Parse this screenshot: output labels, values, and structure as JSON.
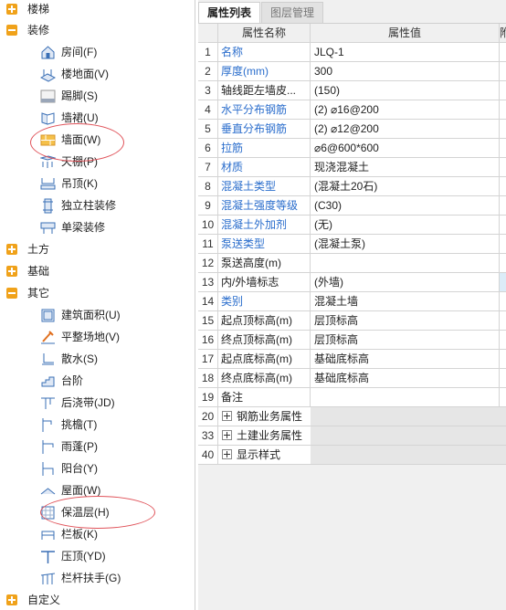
{
  "tree": {
    "categories": {
      "stairs": "楼梯",
      "decoration": "装修",
      "earthwork": "土方",
      "foundation": "基础",
      "other": "其它",
      "custom": "自定义"
    },
    "decoration_items": [
      "房间(F)",
      "楼地面(V)",
      "踢脚(S)",
      "墙裙(U)",
      "墙面(W)",
      "天棚(P)",
      "吊顶(K)",
      "独立柱装修",
      "单梁装修"
    ],
    "other_items": [
      "建筑面积(U)",
      "平整场地(V)",
      "散水(S)",
      "台阶",
      "后浇带(JD)",
      "挑檐(T)",
      "雨蓬(P)",
      "阳台(Y)",
      "屋面(W)",
      "保温层(H)",
      "栏板(K)",
      "压顶(YD)",
      "栏杆扶手(G)"
    ]
  },
  "tabs": {
    "properties": "属性列表",
    "layers": "图层管理"
  },
  "grid": {
    "headers": {
      "name": "属性名称",
      "value": "属性值",
      "extra": "附"
    },
    "rows": [
      {
        "no": "1",
        "name": "名称",
        "value": "JLQ-1",
        "blue": true
      },
      {
        "no": "2",
        "name": "厚度(mm)",
        "value": "300",
        "blue": true
      },
      {
        "no": "3",
        "name": "轴线距左墙皮...",
        "value": "(150)",
        "blue": false
      },
      {
        "no": "4",
        "name": "水平分布钢筋",
        "value": "(2) ⌀16@200",
        "blue": true
      },
      {
        "no": "5",
        "name": "垂直分布钢筋",
        "value": "(2) ⌀12@200",
        "blue": true
      },
      {
        "no": "6",
        "name": "拉筋",
        "value": "⌀6@600*600",
        "blue": true
      },
      {
        "no": "7",
        "name": "材质",
        "value": "现浇混凝土",
        "blue": true
      },
      {
        "no": "8",
        "name": "混凝土类型",
        "value": "(混凝土20石)",
        "blue": true
      },
      {
        "no": "9",
        "name": "混凝土强度等级",
        "value": "(C30)",
        "blue": true
      },
      {
        "no": "10",
        "name": "混凝土外加剂",
        "value": "(无)",
        "blue": true
      },
      {
        "no": "11",
        "name": "泵送类型",
        "value": "(混凝土泵)",
        "blue": true
      },
      {
        "no": "12",
        "name": "泵送高度(m)",
        "value": "",
        "blue": false
      },
      {
        "no": "13",
        "name": "内/外墙标志",
        "value": "(外墙)",
        "blue": false
      },
      {
        "no": "14",
        "name": "类别",
        "value": "混凝土墙",
        "blue": true
      },
      {
        "no": "15",
        "name": "起点顶标高(m)",
        "value": "层顶标高",
        "blue": false
      },
      {
        "no": "16",
        "name": "终点顶标高(m)",
        "value": "层顶标高",
        "blue": false
      },
      {
        "no": "17",
        "name": "起点底标高(m)",
        "value": "基础底标高",
        "blue": false
      },
      {
        "no": "18",
        "name": "终点底标高(m)",
        "value": "基础底标高",
        "blue": false
      },
      {
        "no": "19",
        "name": "备注",
        "value": "",
        "blue": false
      }
    ],
    "groups": [
      {
        "no": "20",
        "name": "钢筋业务属性"
      },
      {
        "no": "33",
        "name": "土建业务属性"
      },
      {
        "no": "40",
        "name": "显示样式"
      }
    ]
  }
}
